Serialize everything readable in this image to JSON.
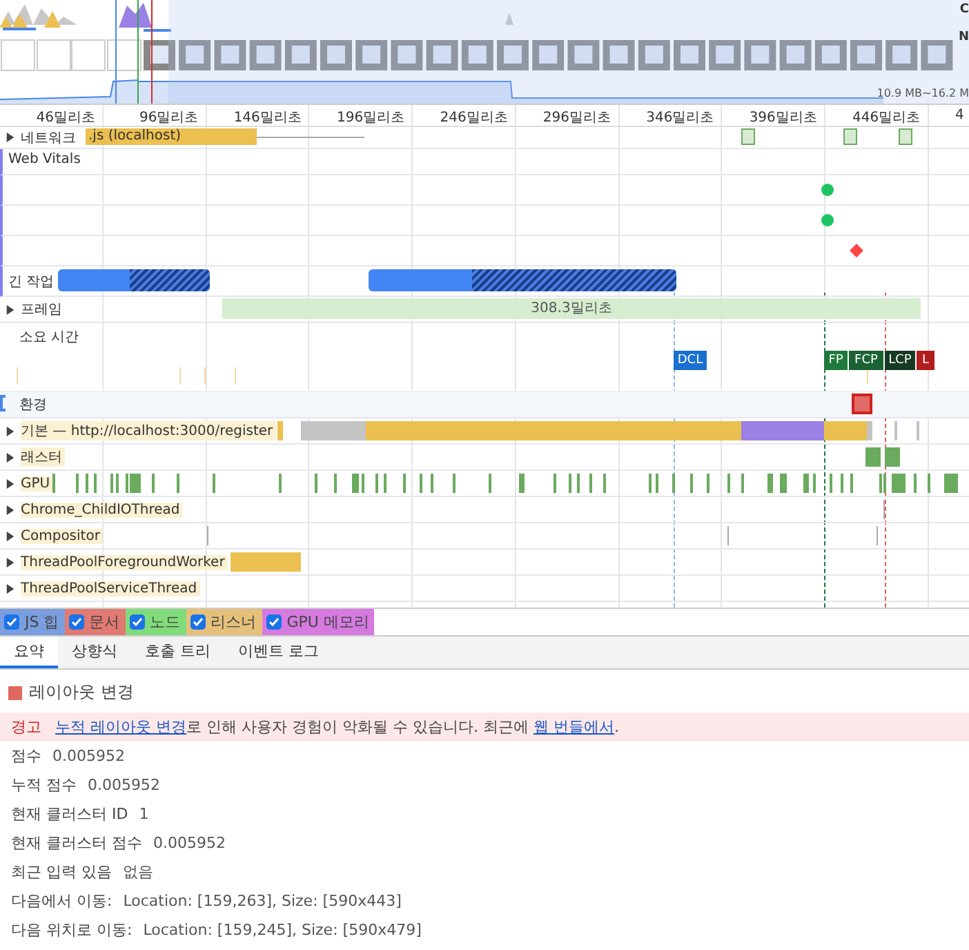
{
  "overview": {
    "cpu_label": "C",
    "net_label": "N",
    "memory_range": "10.9 MB~16.2 M"
  },
  "ruler": {
    "ticks": [
      "46밀리초",
      "96밀리초",
      "146밀리초",
      "196밀리초",
      "246밀리초",
      "296밀리초",
      "346밀리초",
      "396밀리초",
      "446밀리초",
      "4"
    ]
  },
  "network": {
    "label": "네트워크",
    "expanded": false,
    "request": ".js (localhost)"
  },
  "web_vitals": {
    "label": "Web Vitals"
  },
  "long_tasks": {
    "label": "긴 작업"
  },
  "frames": {
    "label": "프레임",
    "expanded": false,
    "duration": "308.3밀리초"
  },
  "timings": {
    "label": "소요 시간",
    "markers": [
      {
        "label": "DCL",
        "color": "#1a6fd0"
      },
      {
        "label": "FP",
        "color": "#1e7a3c"
      },
      {
        "label": "FCP",
        "color": "#1b6233"
      },
      {
        "label": "LCP",
        "color": "#173a24"
      },
      {
        "label": "L",
        "color": "#b21d1d"
      }
    ]
  },
  "layout_shifts": {
    "label": "환경"
  },
  "threads": [
    {
      "label": "기본 — http://localhost:3000/register",
      "expanded": false
    },
    {
      "label": "래스터",
      "expanded": false
    },
    {
      "label": "GPU",
      "expanded": false
    },
    {
      "label": "Chrome_ChildIOThread",
      "expanded": false
    },
    {
      "label": "Compositor",
      "expanded": false
    },
    {
      "label": "ThreadPoolForegroundWorker",
      "expanded": false
    },
    {
      "label": "ThreadPoolServiceThread",
      "expanded": false
    }
  ],
  "memory_counters": [
    {
      "label": "JS 힙",
      "checked": true,
      "color": "#7b9ee0"
    },
    {
      "label": "문서",
      "checked": true,
      "color": "#e07a72"
    },
    {
      "label": "노드",
      "checked": true,
      "color": "#80dc7a"
    },
    {
      "label": "리스너",
      "checked": true,
      "color": "#e6c07a"
    },
    {
      "label": "GPU 메모리",
      "checked": true,
      "color": "#d67ae0"
    }
  ],
  "tabs": [
    {
      "label": "요약",
      "selected": true
    },
    {
      "label": "상향식",
      "selected": false
    },
    {
      "label": "호출 트리",
      "selected": false
    },
    {
      "label": "이벤트 로그",
      "selected": false
    }
  ],
  "summary": {
    "title": "레이아웃 변경",
    "color": "#e0685e",
    "warning": {
      "label": "경고",
      "link": "누적 레이아웃 변경",
      "text": "로 인해 사용자 경험이 악화될 수 있습니다. 최근에 ",
      "link2": "웹 번들에서",
      "end": "."
    },
    "properties": [
      {
        "label": "점수",
        "value": "0.005952"
      },
      {
        "label": "누적 점수",
        "value": "0.005952"
      },
      {
        "label": "현재 클러스터 ID",
        "value": "1"
      },
      {
        "label": "현재 클러스터 점수",
        "value": "0.005952"
      },
      {
        "label": "최근 입력 있음",
        "value": "없음"
      },
      {
        "label": "다음에서 이동:",
        "value": "Location: [159,263], Size: [590x443]"
      },
      {
        "label": "다음 위치로 이동:",
        "value": "Location: [159,245], Size: [590x479]"
      }
    ]
  }
}
